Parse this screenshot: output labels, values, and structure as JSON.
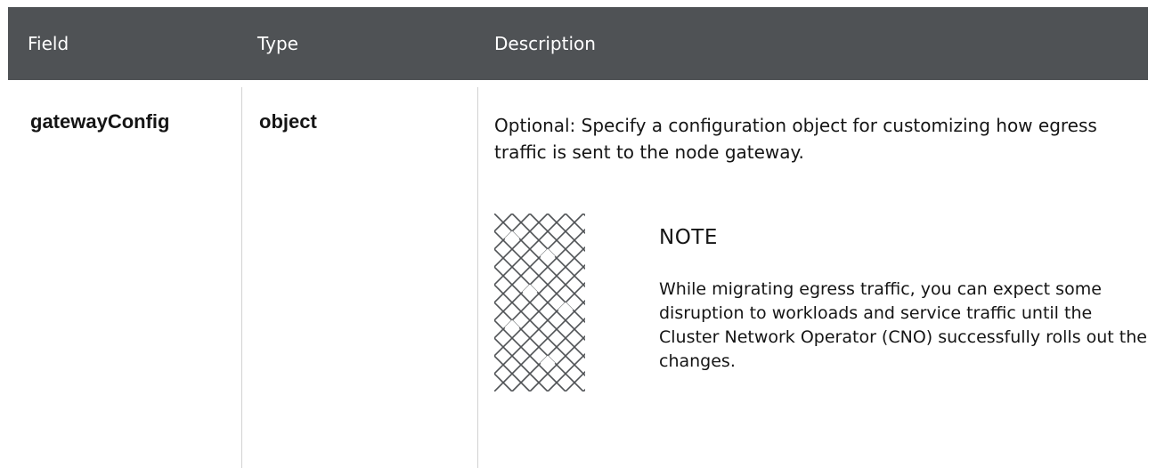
{
  "table": {
    "headers": {
      "field": "Field",
      "type": "Type",
      "description": "Description"
    },
    "rows": [
      {
        "field": "gatewayConfig",
        "type": "object",
        "description": "Optional: Specify a configuration object for customizing how egress traffic is sent to the node gateway.",
        "note": {
          "icon": "note-pattern-icon",
          "title": "NOTE",
          "body": "While migrating egress traffic, you can expect some disruption to workloads and service traffic until the Cluster Network Operator (CNO) successfully rolls out the changes."
        }
      }
    ]
  },
  "colors": {
    "header_background": "#4f5255",
    "header_text": "#ffffff",
    "divider": "#d2d2d2",
    "icon_stroke": "#4f5255"
  }
}
